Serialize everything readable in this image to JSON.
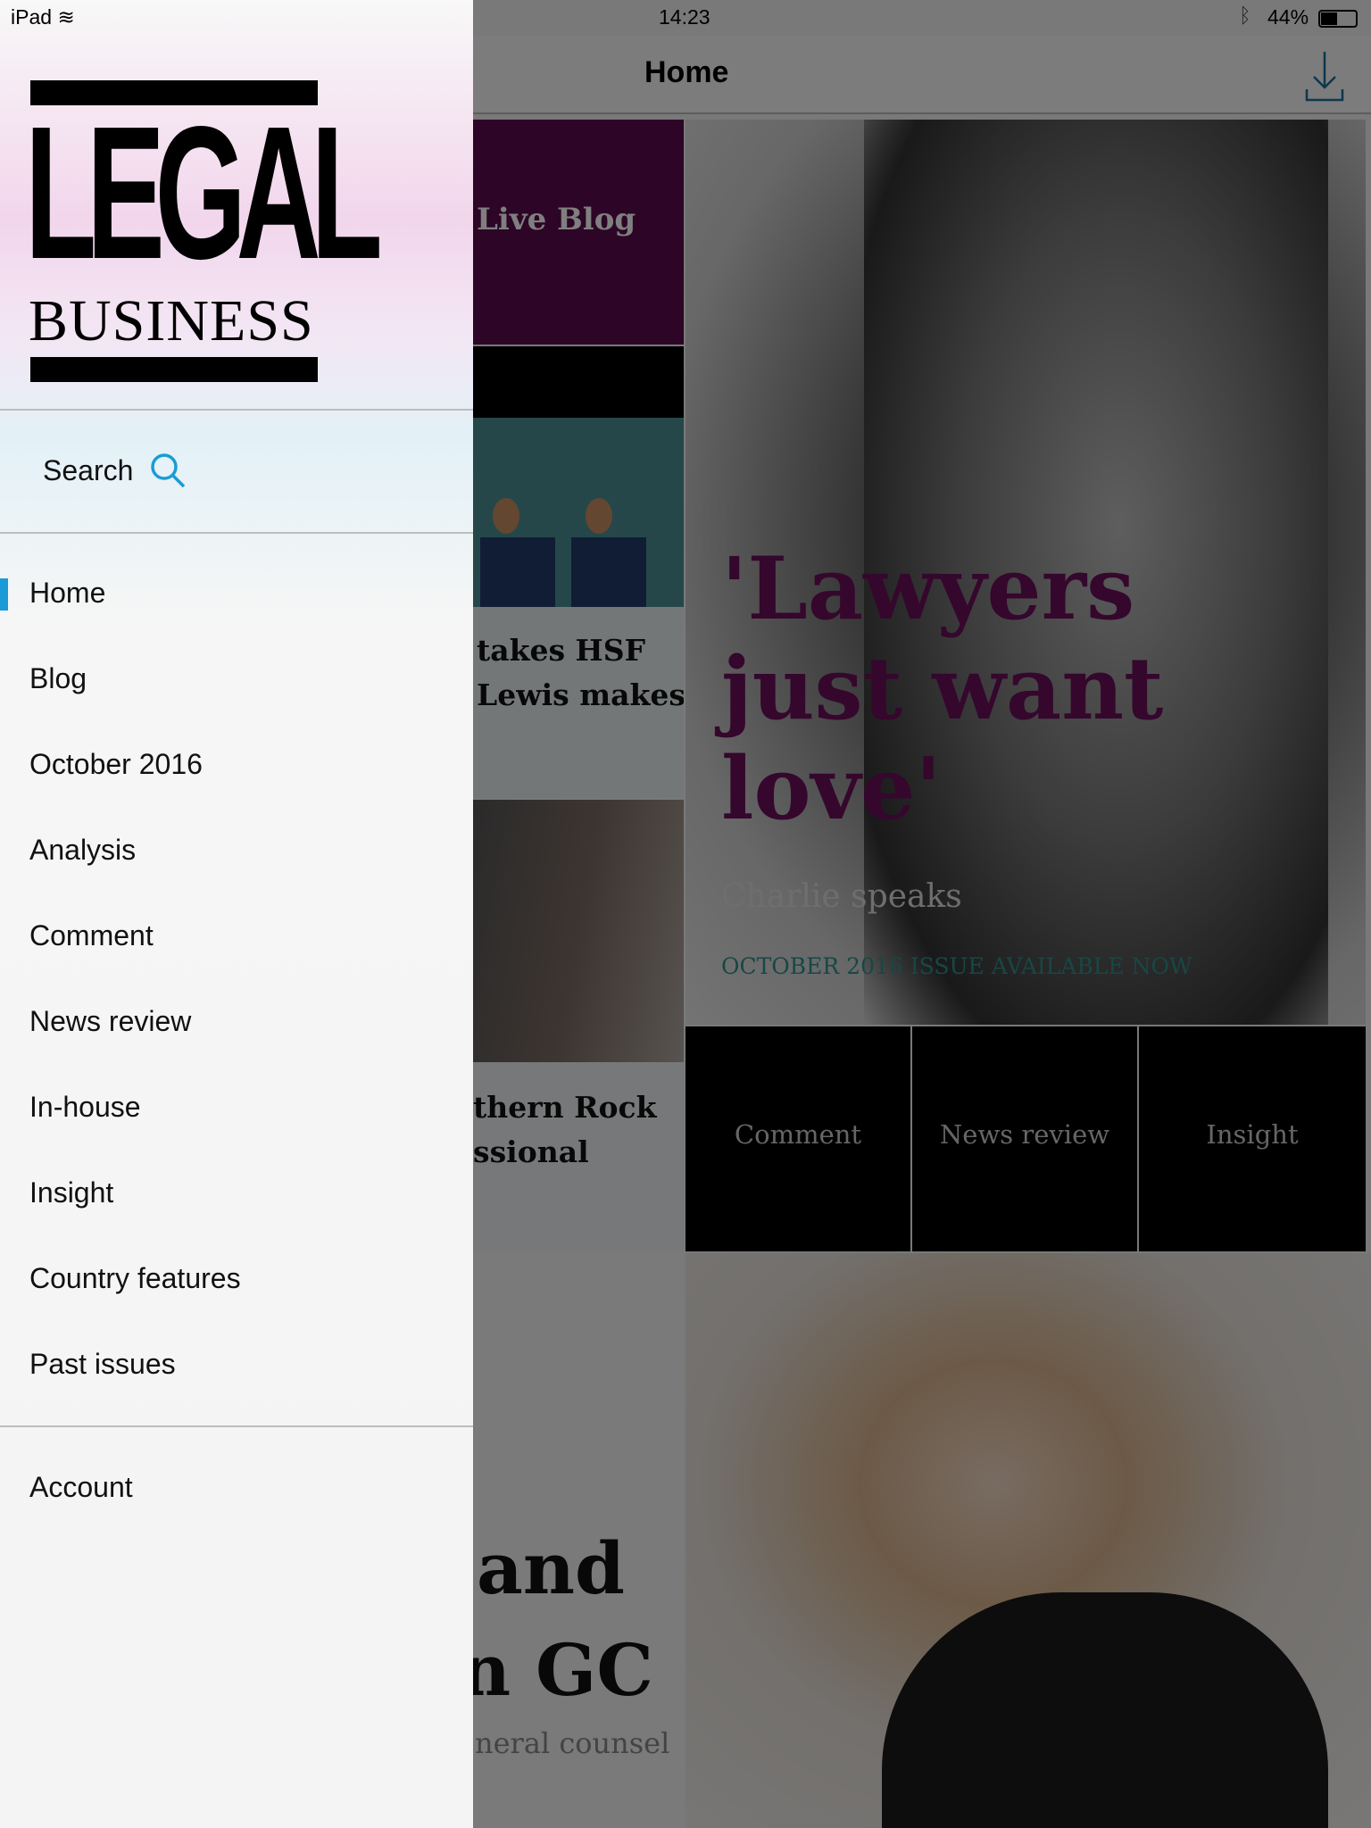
{
  "status_bar": {
    "device": "iPad",
    "time": "14:23",
    "battery": "44%"
  },
  "nav": {
    "title": "Home",
    "download_icon": "download-icon"
  },
  "tiles": {
    "live_blog": "Live Blog",
    "story1": [
      "takes HSF",
      "Lewis makes"
    ],
    "story2": [
      "thern Rock",
      "ssional"
    ],
    "hero": {
      "headline": [
        "'Lawyers",
        "just want",
        "love'"
      ],
      "subtitle": "Charlie speaks",
      "cta": "OCTOBER 2016 ISSUE AVAILABLE NOW"
    },
    "sections": [
      "Comment",
      "News review",
      "Insight"
    ],
    "story3": {
      "headline": [
        "and",
        "n GC"
      ],
      "subtitle": "neral counsel"
    }
  },
  "drawer": {
    "logo": {
      "top": "LEGAL",
      "bottom": "BUSINESS"
    },
    "search_label": "Search",
    "items": [
      "Home",
      "Blog",
      "October 2016",
      "Analysis",
      "Comment",
      "News review",
      "In-house",
      "Insight",
      "Country features",
      "Past issues"
    ],
    "active_item": "Home",
    "account": "Account"
  },
  "colors": {
    "accent": "#1a9bd7",
    "brand_purple": "#6a0f5a",
    "live_blog_bg": "#5a0a4c"
  }
}
